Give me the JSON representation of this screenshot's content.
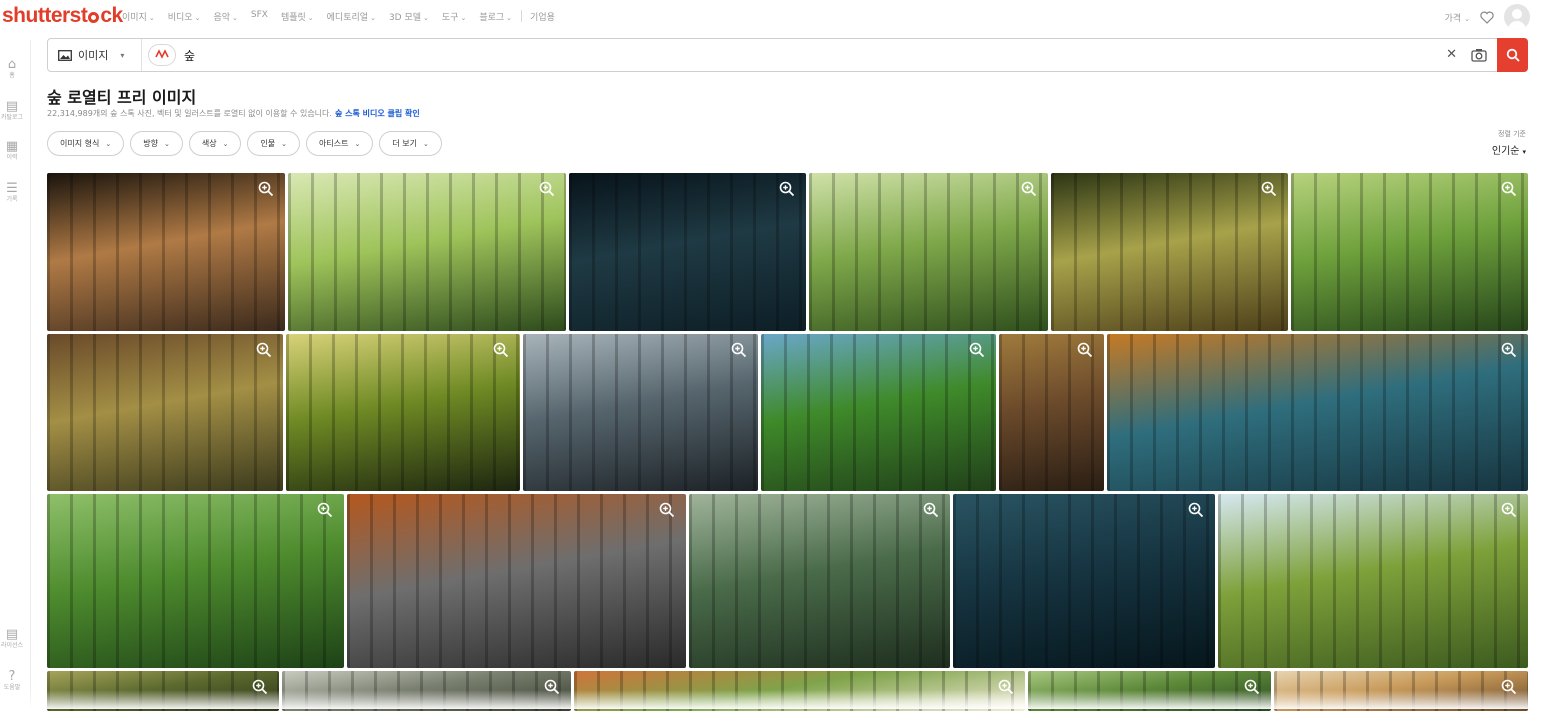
{
  "brand": {
    "logo_prefix": "shutterst",
    "logo_suffix": "ck",
    "accent": "#e23d28"
  },
  "nav": {
    "items": [
      {
        "label": "이미지",
        "caret": true
      },
      {
        "label": "비디오",
        "caret": true
      },
      {
        "label": "음악",
        "caret": true
      },
      {
        "label": "SFX",
        "caret": false
      },
      {
        "label": "템플릿",
        "caret": true
      },
      {
        "label": "에디토리얼",
        "caret": true
      },
      {
        "label": "3D 모델",
        "caret": true
      },
      {
        "label": "도구",
        "caret": true
      },
      {
        "label": "블로그",
        "caret": true
      },
      {
        "label": "기업용",
        "caret": false
      }
    ],
    "pricing_label": "가격",
    "heart_icon": "heart-icon",
    "avatar_icon": "user-avatar-icon"
  },
  "sidebar": {
    "items": [
      {
        "icon": "home-icon",
        "glyph": "⌂",
        "label": "홈"
      },
      {
        "icon": "catalog-icon",
        "glyph": "▤",
        "label": "카탈로그"
      },
      {
        "icon": "collection-icon",
        "glyph": "▦",
        "label": "이력"
      },
      {
        "icon": "history-icon",
        "glyph": "☰",
        "label": "기록"
      },
      {
        "icon": "license-icon",
        "glyph": "▤",
        "label": "라이선스"
      },
      {
        "icon": "help-icon",
        "glyph": "?",
        "label": "도움말"
      }
    ]
  },
  "search": {
    "type_label": "이미지",
    "ai_label": "AI",
    "query": "숲",
    "placeholder": "",
    "clear_icon": "close-icon",
    "camera_icon": "camera-icon",
    "button_icon": "search-icon"
  },
  "page": {
    "title": "숲 로열티 프리 이미지",
    "subtitle": "22,314,989개의 숲 스톡 사진, 벡터 및 일러스트를 로열티 없이 이용할 수 있습니다.",
    "subtitle_link": "숲 스톡 비디오 클립 확인"
  },
  "filters": [
    {
      "label": "이미지 형식"
    },
    {
      "label": "방향"
    },
    {
      "label": "색상"
    },
    {
      "label": "인물"
    },
    {
      "label": "아티스트"
    },
    {
      "label": "더 보기"
    }
  ],
  "sort": {
    "label": "정렬 기준",
    "value": "인기순"
  },
  "images": [
    {
      "subject": "sunbeams through dark pine forest",
      "colors": [
        "#3b2a1c",
        "#b07a45",
        "#1a140d"
      ]
    },
    {
      "subject": "bright green forest with tall trunks",
      "colors": [
        "#2d4a1c",
        "#9ec35a",
        "#d9e8b4"
      ]
    },
    {
      "subject": "dark blue misty forest at night",
      "colors": [
        "#0d1e26",
        "#1f3a44",
        "#08131a"
      ]
    },
    {
      "subject": "green leafy forest with grass",
      "colors": [
        "#2f4f1d",
        "#7fa84a",
        "#cfe1a8"
      ]
    },
    {
      "subject": "sunlit beech forest",
      "colors": [
        "#4d3f1a",
        "#a7a24a",
        "#2c3514"
      ]
    },
    {
      "subject": "green forest path",
      "colors": [
        "#27461b",
        "#6ea13c",
        "#b7d27d"
      ]
    },
    {
      "subject": "autumn forest trail",
      "colors": [
        "#3b3a1d",
        "#a38f45",
        "#6a4a2a"
      ]
    },
    {
      "subject": "sun behind large oak trees",
      "colors": [
        "#1d2510",
        "#6f8a24",
        "#d9d27a"
      ]
    },
    {
      "subject": "grey foggy forest with light",
      "colors": [
        "#1c2226",
        "#56656d",
        "#a8b4ba"
      ]
    },
    {
      "subject": "green grass path between conifers",
      "colors": [
        "#21401a",
        "#3f8a2a",
        "#6aa7c9"
      ]
    },
    {
      "subject": "pine trunks in sunset",
      "colors": [
        "#2a1e14",
        "#6b4a2b",
        "#a07a3c"
      ]
    },
    {
      "subject": "foggy blue forest with orange leaves",
      "colors": [
        "#173540",
        "#2f6e7d",
        "#c67a24"
      ]
    },
    {
      "subject": "green forest with river",
      "colors": [
        "#1e4217",
        "#4e8c2e",
        "#8fc06a"
      ]
    },
    {
      "subject": "dark foggy forest in autumn",
      "colors": [
        "#2a2a2a",
        "#6e6e6e",
        "#b5581e"
      ]
    },
    {
      "subject": "misty green forest with large trunks",
      "colors": [
        "#1e2e1e",
        "#4a6b4a",
        "#a0b49a"
      ]
    },
    {
      "subject": "dark teal forest at night",
      "colors": [
        "#06161c",
        "#163441",
        "#2a5462"
      ]
    },
    {
      "subject": "river valley in green forest",
      "colors": [
        "#3d5a1f",
        "#7ea13a",
        "#d6e8f0"
      ]
    },
    {
      "subject": "forest canopy",
      "colors": [
        "#2b3417",
        "#5c6a2f",
        "#a7a55a"
      ]
    },
    {
      "subject": "tall forest trunks",
      "colors": [
        "#3a4030",
        "#7a8070",
        "#c8ccc0"
      ]
    },
    {
      "subject": "illustrated forest pattern",
      "colors": [
        "#f3ecd9",
        "#7fa34a",
        "#d0743a"
      ]
    },
    {
      "subject": "green forest",
      "colors": [
        "#2a4a1f",
        "#5e8a3a",
        "#a8c880"
      ]
    },
    {
      "subject": "warm forest bokeh",
      "colors": [
        "#6a4a2a",
        "#c89a5a",
        "#e8d4b0"
      ]
    }
  ]
}
